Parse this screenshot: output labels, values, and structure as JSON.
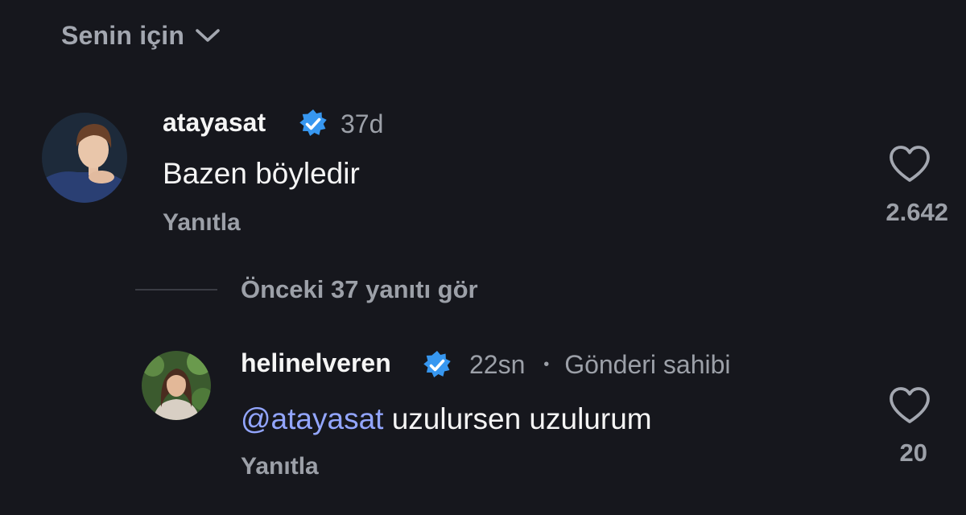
{
  "sort": {
    "label": "Senin için",
    "icon": "chevron-down-icon"
  },
  "comments": [
    {
      "username": "atayasat",
      "verified": true,
      "time": "37d",
      "text": "Bazen böyledir",
      "reply_label": "Yanıtla",
      "likes": "2.642"
    }
  ],
  "view_replies": "Önceki 37 yanıtı gör",
  "replies": [
    {
      "username": "helinelveren",
      "verified": true,
      "time": "22sn",
      "separator": "•",
      "author_tag": "Gönderi sahibi",
      "mention": "@atayasat",
      "text": " uzulursen uzulurum",
      "reply_label": "Yanıtla",
      "likes": "20"
    }
  ],
  "colors": {
    "background": "#16171d",
    "primary_text": "#f5f5f5",
    "secondary_text": "#9ca0a8",
    "verified_badge": "#3797f0",
    "mention": "#93a6ff"
  }
}
